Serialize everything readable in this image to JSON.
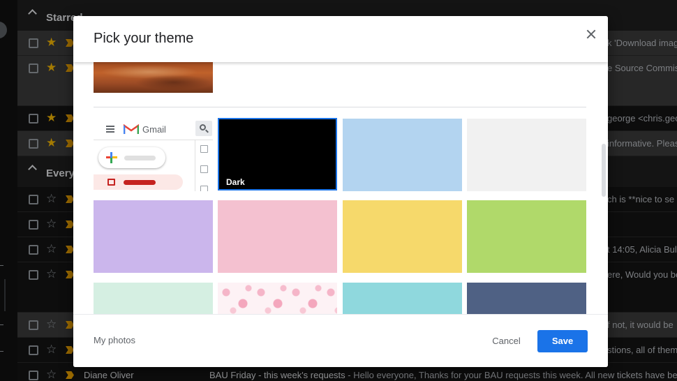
{
  "background": {
    "sections": {
      "starred": "Starred",
      "everything": "Every"
    },
    "rows": [
      {
        "snippet": "k 'Download imag"
      },
      {
        "snippet": "e Source Commis"
      },
      {
        "snippet": "george <chris.geor"
      },
      {
        "snippet": "informative. Pleas"
      },
      {
        "snippet": "ch is **nice to se"
      },
      {
        "snippet": ""
      },
      {
        "snippet": "t 14:05, Alicia Bul"
      },
      {
        "snippet": "ere, Would you be"
      },
      {
        "snippet": "f not, it would be"
      },
      {
        "snippet": "stions, all of them"
      }
    ],
    "last_row": {
      "sender": "Diane Oliver",
      "subject": "BAU Friday - this week's requests",
      "preview": " - Hello everyone, Thanks for your BAU requests this week. All new tickets have been"
    }
  },
  "dialog": {
    "title": "Pick your theme",
    "preview_app_name": "Gmail",
    "themes": [
      {
        "name": "dark",
        "label": "Dark",
        "color": "#000000",
        "selected": true
      },
      {
        "name": "light-blue",
        "label": "",
        "color": "#b3d4f0"
      },
      {
        "name": "light-gray",
        "label": "",
        "color": "#f1f1f1"
      },
      {
        "name": "lavender",
        "label": "",
        "color": "#cbb6ec"
      },
      {
        "name": "pink",
        "label": "",
        "color": "#f4c1d0"
      },
      {
        "name": "yellow",
        "label": "",
        "color": "#f6d96b"
      },
      {
        "name": "green",
        "label": "",
        "color": "#b0d96a"
      },
      {
        "name": "mint",
        "label": "",
        "color": "#d5efe2"
      },
      {
        "name": "cherry-blossom",
        "label": "",
        "color": "#fdf2f5"
      },
      {
        "name": "turquoise",
        "label": "",
        "color": "#8fd8dd"
      },
      {
        "name": "slate-blue",
        "label": "",
        "color": "#4f6184"
      }
    ],
    "footer": {
      "my_photos": "My photos",
      "cancel": "Cancel",
      "save": "Save"
    }
  }
}
